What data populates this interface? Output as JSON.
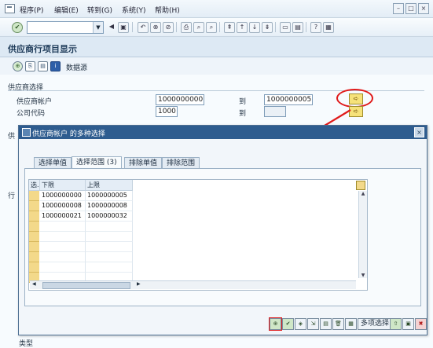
{
  "menu": {
    "items": [
      "程序(P)",
      "编辑(E)",
      "转到(G)",
      "系统(Y)",
      "帮助(H)"
    ]
  },
  "toolbar": {
    "command_value": ""
  },
  "title": "供应商行项目显示",
  "app_toolbar": {
    "datasource_label": "数据源"
  },
  "selection_group": {
    "header": "供应商选择",
    "vendor_label": "供应商帐户",
    "vendor_from": "1000000000",
    "to_label_1": "到",
    "vendor_to": "1000000005",
    "company_label": "公司代码",
    "company_from": "1000",
    "to_label_2": "到",
    "company_to": ""
  },
  "side_labels": {
    "a": "供",
    "b": "行",
    "c": "类型"
  },
  "dialog": {
    "title": "供应商帐户 的多种选择",
    "tabs": [
      "选择单值",
      "选择范围 (3)",
      "排除单值",
      "排除范围"
    ],
    "active_tab": 1,
    "table": {
      "headers": [
        "选.",
        "下限",
        "上限"
      ],
      "rows": [
        [
          "1000000000",
          "1000000005"
        ],
        [
          "1000000008",
          "1000000008"
        ],
        [
          "1000000021",
          "1000000032"
        ]
      ]
    },
    "buttons": {
      "multi_select_label": "多项选择"
    }
  },
  "colors": {
    "highlight": "#e01a1a",
    "dialog_title": "#2e5c8f"
  }
}
